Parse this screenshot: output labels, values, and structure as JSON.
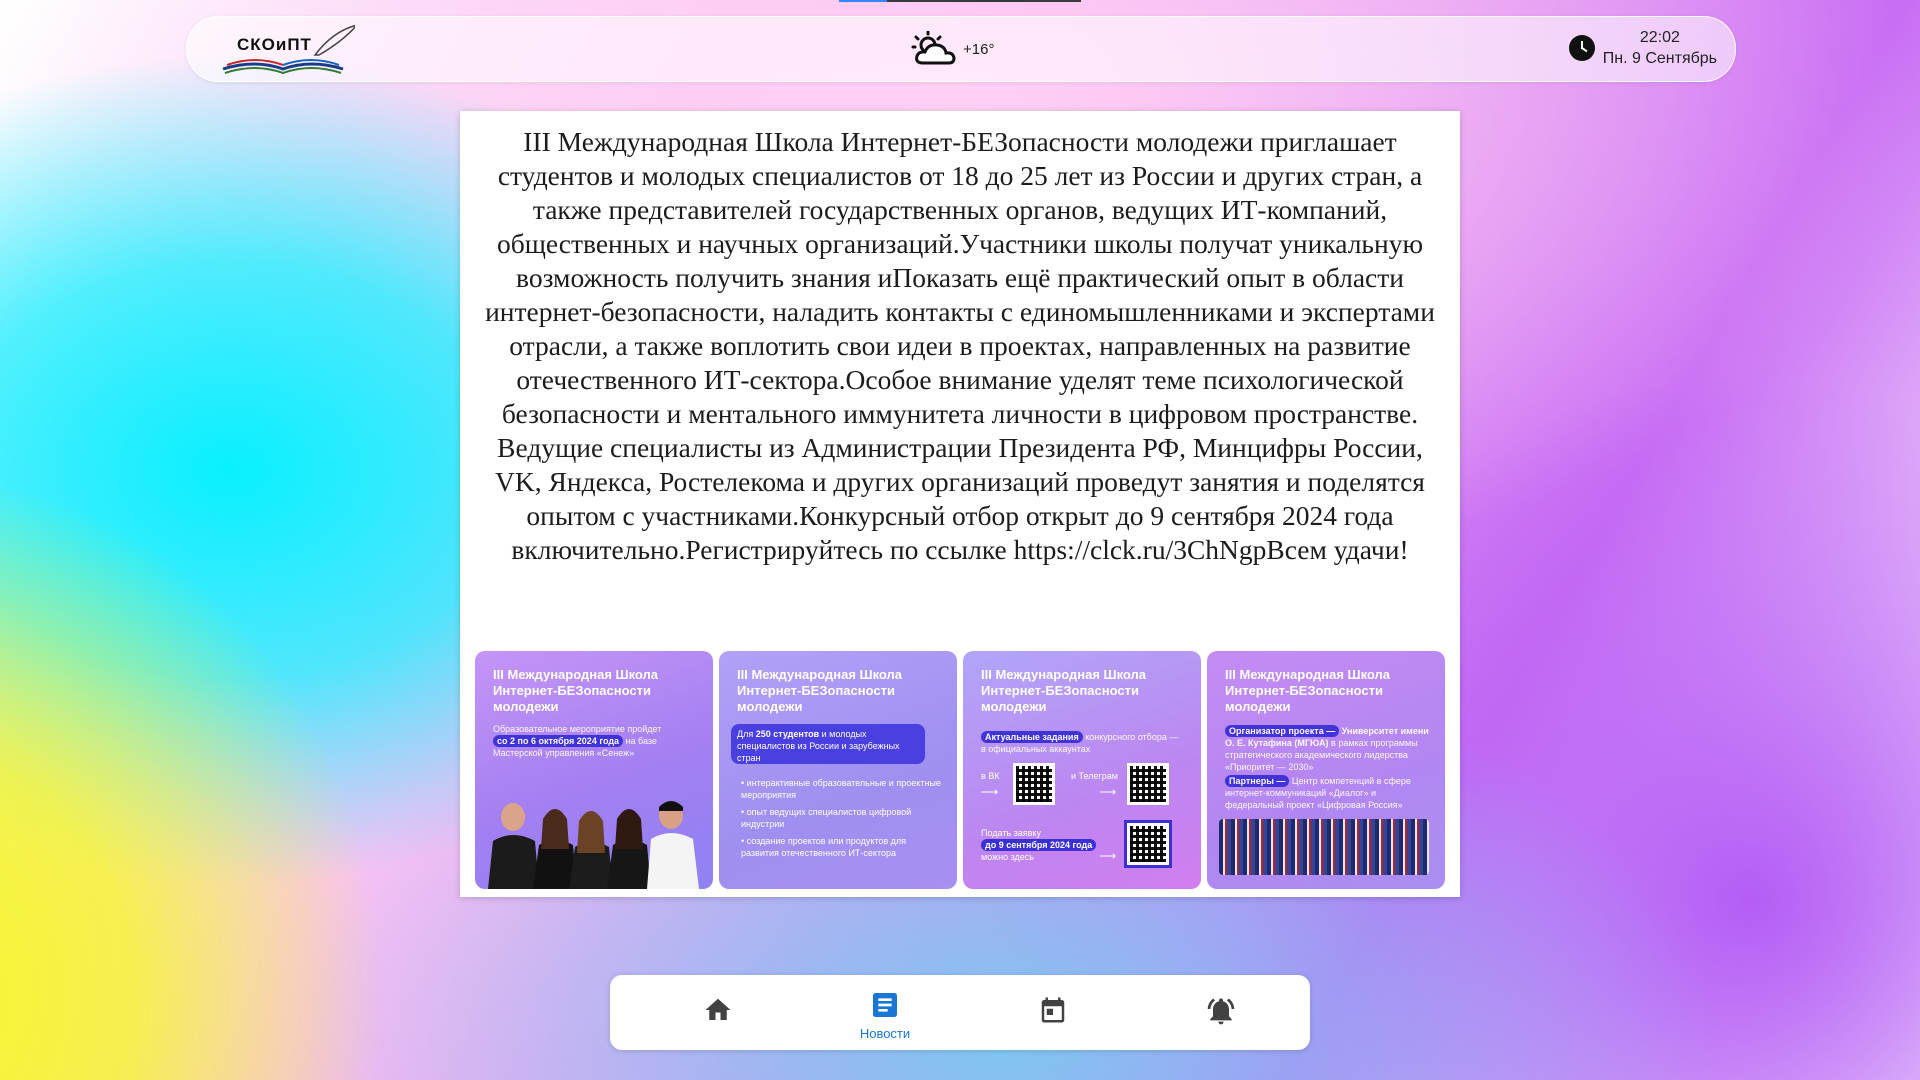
{
  "header": {
    "logo_text": "СКОиПТ",
    "weather": {
      "icon": "partly-cloudy-icon",
      "temperature": "+16°"
    },
    "clock": {
      "time": "22:02",
      "date": "Пн. 9 Сентябрь"
    }
  },
  "post": {
    "text": "III Международная Школа Интернет-БЕЗопасности молодежи приглашает студентов и молодых специалистов от 18 до 25 лет из России и других стран, а также представителей государственных органов, ведущих ИТ-компаний, общественных и научных организаций.Участники школы получат уникальную возможность получить знания иПоказать ещё практический опыт в области интернет-безопасности, наладить контакты с единомышленниками и экспертами отрасли, а также воплотить свои идеи в проектах, направленных на развитие отечественного ИТ-сектора.Особое внимание уделят теме психологической безопасности и ментального иммунитета личности в цифровом пространстве. Ведущие специалисты из Администрации Президента РФ, Минцифры России, VK, Яндекса, Ростелекома и других организаций проведут занятия и поделятся опытом с участниками.Конкурсный отбор открыт до 9 сентября 2024 года включительно.Регистрируйтесь по ссылке https://clck.ru/3ChNgpВсем удачи!",
    "slides": [
      {
        "title": "III Международная Школа Интернет-БЕЗопасности молодежи",
        "text_before": "Образовательное мероприятие пройдет ",
        "highlight": "со 2 по 6 октября 2024 года",
        "text_after": " на базе Мастерской управления «Сенеж»"
      },
      {
        "title": "III Международная Школа Интернет-БЕЗопасности молодежи",
        "box_prefix": "Для ",
        "box_highlight": "250 студентов",
        "box_suffix": " и молодых специалистов из России и зарубежных стран",
        "bullets": [
          "интерактивные образовательные и проектные мероприятия",
          "опыт ведущих специалистов цифровой индустрии",
          "создание проектов или продуктов для развития отечественного ИТ-сектора"
        ]
      },
      {
        "title": "III Международная Школа Интернет-БЕЗопасности молодежи",
        "highlight": "Актуальные задания",
        "text_after": " конкурсного отбора — в официальных аккаунтах",
        "vk_label": "в ВК",
        "tg_label": "и Телеграм",
        "apply_text": "Подать заявку",
        "deadline": "до 9 сентября 2024 года",
        "apply_suffix": "можно здесь"
      },
      {
        "title": "III Международная Школа Интернет-БЕЗопасности молодежи",
        "org_label": "Организатор проекта —",
        "org_name": "Университет имени О. Е. Кутафина (МГЮА)",
        "org_text": " в рамках программы стратегического академического лидерства «Приоритет — 2030»",
        "partners_label": "Партнеры —",
        "partners_text": " Центр компетенций в сфере интернет-коммуникаций «Диалог» и федеральный проект «Цифровая Россия»"
      }
    ]
  },
  "nav": {
    "items": [
      {
        "icon": "home-icon",
        "label": ""
      },
      {
        "icon": "news-icon",
        "label": "Новости",
        "active": true
      },
      {
        "icon": "calendar-icon",
        "label": ""
      },
      {
        "icon": "notification-bell-icon",
        "label": ""
      }
    ]
  },
  "colors": {
    "accent": "#1976d2",
    "slide_highlight": "#3b2fd6"
  }
}
